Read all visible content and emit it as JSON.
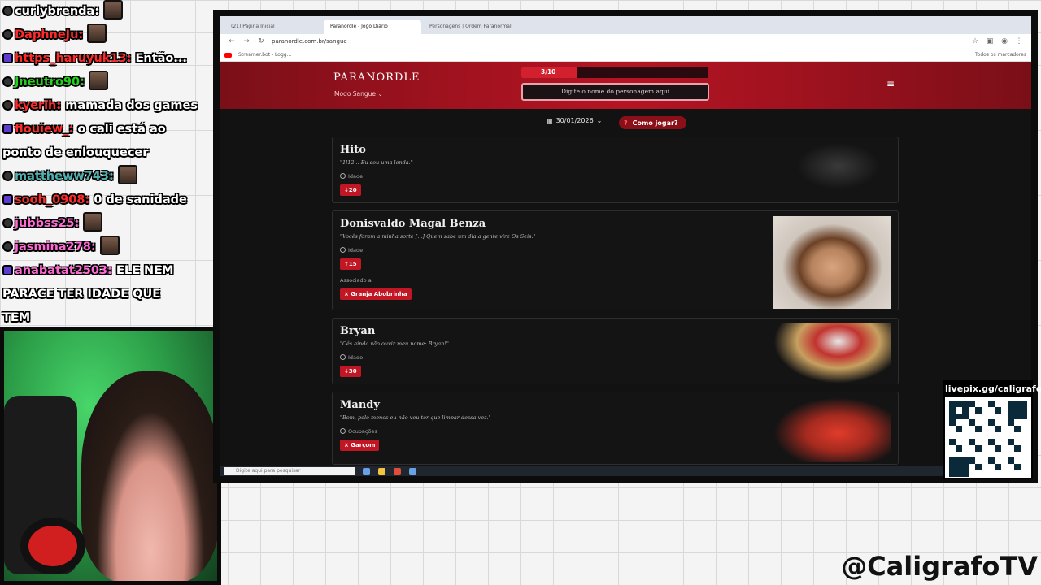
{
  "chat": [
    {
      "user": "curlybrenda:",
      "user_color": "#ffffff",
      "msg": ""
    },
    {
      "user": "DaphneJu:",
      "user_color": "#ff2a2a",
      "msg": ""
    },
    {
      "user": "https_haruyuk13:",
      "user_color": "#ff2a2a",
      "msg": "Então..."
    },
    {
      "user": "Jneutro90:",
      "user_color": "#22d11a",
      "msg": ""
    },
    {
      "user": "kyerih:",
      "user_color": "#ff2a2a",
      "msg": "mamada dos games"
    },
    {
      "user": "flouiew_:",
      "user_color": "#ff2a2a",
      "msg": "o cali está ao"
    },
    {
      "user": "",
      "user_color": "#ffffff",
      "msg": "ponto de enlouquecer"
    },
    {
      "user": "mattheww743:",
      "user_color": "#4fb0b0",
      "msg": ""
    },
    {
      "user": "sooh_0908:",
      "user_color": "#ff2a2a",
      "msg": "0 de sanidade"
    },
    {
      "user": "jubbss25:",
      "user_color": "#ff6ad5",
      "msg": ""
    },
    {
      "user": "jasmina278:",
      "user_color": "#ff6ad5",
      "msg": ""
    },
    {
      "user": "anabatat2503:",
      "user_color": "#ff6ad5",
      "msg": "ELE NEM"
    },
    {
      "user": "",
      "user_color": "#ffffff",
      "msg": "PARACE TER  IDADE QUE"
    },
    {
      "user": "",
      "user_color": "#ffffff",
      "msg": "TEM"
    }
  ],
  "browser": {
    "tabs": [
      "(21) Página Inicial",
      "Paranordle - Jogo Diário",
      "Personagens | Ordem Paranormal"
    ],
    "url": "paranordle.com.br/sangue",
    "bookmark": "Streamer.bot - Logg...",
    "bookmark_right": "Todos os marcadores"
  },
  "site": {
    "logo": "PARANORDLE",
    "mode": "Modo Sangue",
    "progress_label": "3/10",
    "progress_fraction": 0.3,
    "search_placeholder": "Digite o nome do personagem aqui",
    "date": "30/01/2026",
    "help_label": "Como jogar?"
  },
  "cards": [
    {
      "name": "Hito",
      "quote": "\"1l12... Eu sou uma lenda.\"",
      "label": "Idade",
      "chip": "↓20",
      "extra_label": "",
      "extra_chip": ""
    },
    {
      "name": "Donisvaldo Magal Benza",
      "quote": "\"Vocês foram a minha sorte [...] Quem sabe um dia a gente vire Os Seis.\"",
      "label": "Idade",
      "chip": "↑15",
      "extra_label": "Associado a",
      "extra_chip": "× Granja Abobrinha"
    },
    {
      "name": "Bryan",
      "quote": "\"Cês ainda vão ouvir meu nome: Bryan!\"",
      "label": "Idade",
      "chip": "↓30",
      "extra_label": "",
      "extra_chip": ""
    },
    {
      "name": "Mandy",
      "quote": "\"Bom, pelo menos eu não vou ter que limpar dessa vez.\"",
      "label": "Ocupações",
      "chip": "× Garçom",
      "extra_label": "",
      "extra_chip": ""
    }
  ],
  "taskbar": {
    "search_placeholder": "Digite aqui para pesquisar"
  },
  "overlay": {
    "qr_label": "livepix.gg/caligrafo",
    "handle": "@CaligrafoTV"
  },
  "colors": {
    "accent": "#c11725",
    "header": "#a1121f"
  }
}
